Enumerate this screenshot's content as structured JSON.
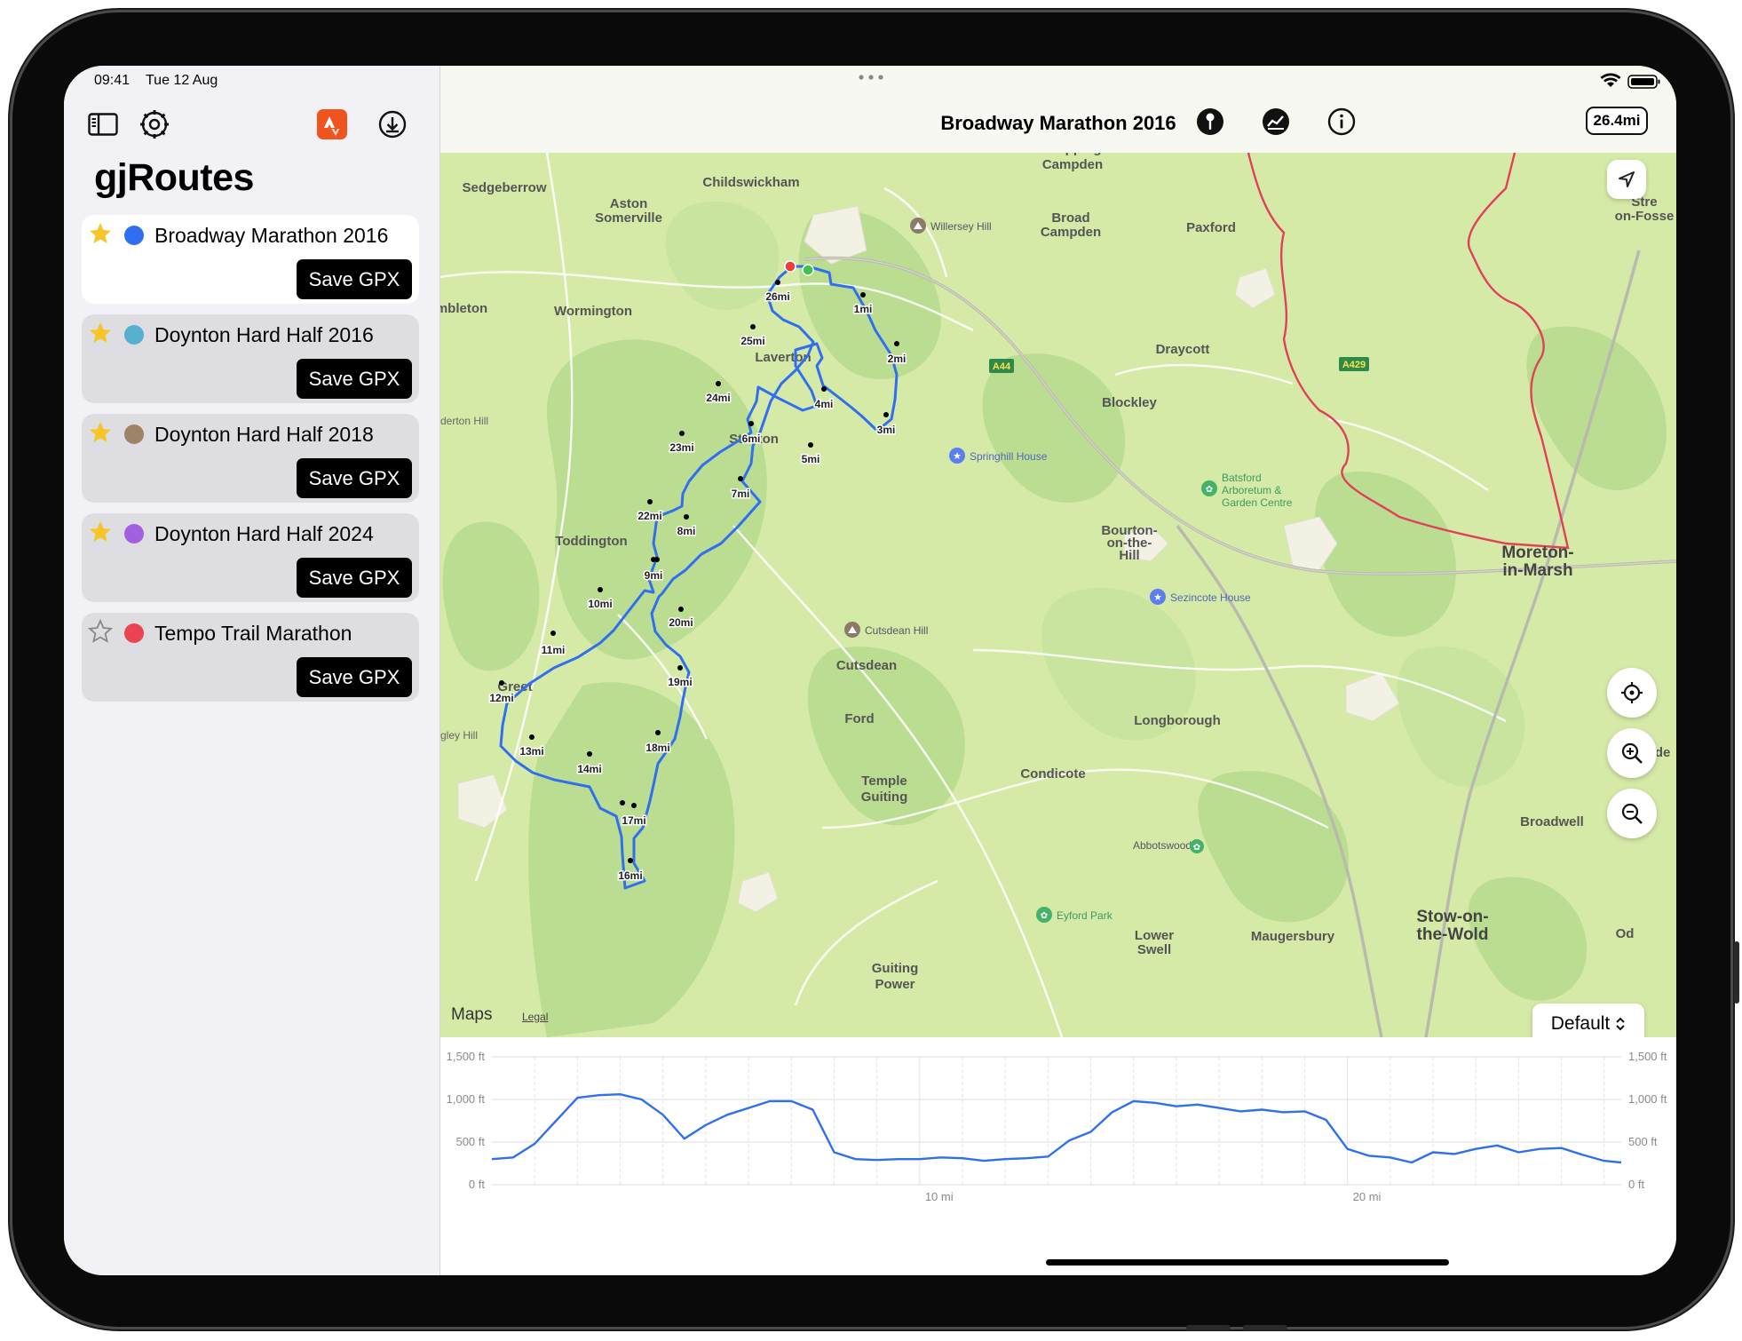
{
  "status": {
    "time": "09:41",
    "date": "Tue 12 Aug"
  },
  "sidebar": {
    "title": "gjRoutes",
    "toolbar_icons": [
      "sidebar-toggle-icon",
      "gear-icon",
      "strava-icon",
      "download-icon"
    ],
    "routes": [
      {
        "name": "Broadway Marathon 2016",
        "color": "#2f6ff0",
        "favorite": true,
        "selected": true,
        "action": "Save GPX"
      },
      {
        "name": "Doynton Hard Half 2016",
        "color": "#57b0cf",
        "favorite": true,
        "selected": false,
        "action": "Save GPX"
      },
      {
        "name": "Doynton Hard Half 2018",
        "color": "#9e8366",
        "favorite": true,
        "selected": false,
        "action": "Save GPX"
      },
      {
        "name": "Doynton Hard Half 2024",
        "color": "#a25fe0",
        "favorite": true,
        "selected": false,
        "action": "Save GPX"
      },
      {
        "name": "Tempo Trail Marathon",
        "color": "#ea4452",
        "favorite": false,
        "selected": false,
        "action": "Save GPX"
      }
    ]
  },
  "navbar": {
    "title": "Broadway Marathon 2016",
    "distance": "26.4mi",
    "icons": [
      "pin-icon",
      "chart-icon",
      "info-icon"
    ]
  },
  "map": {
    "attribution": "Maps",
    "legal": "Legal",
    "map_style": "Default",
    "route_color": "#2f6ff0",
    "places": [
      "Chipping Campden",
      "Sedgeberrow",
      "Childswickham",
      "Aston Somerville",
      "Willersey Hill",
      "Broad Campden",
      "Paxford",
      "Stretton-on-Fosse",
      "Wormington",
      "Laverton",
      "Draycott",
      "Blockley",
      "Springhill House",
      "Stanton",
      "Batsford Arboretum & Garden Centre",
      "Toddington",
      "Bourton-on-the-Hill",
      "Moreton-in-Marsh",
      "Sezincote House",
      "Cutsdean",
      "Cutsdean Hill",
      "Greet",
      "Ford",
      "Longborough",
      "Temple Guiting",
      "Condicote",
      "Evenlode",
      "Broadwell",
      "Abbotswood",
      "Stow-on-the-Wold",
      "Lower Swell",
      "Maugersbury",
      "Guiting Power",
      "Eyford Park",
      "Wormington",
      "A44",
      "A429"
    ],
    "mile_markers": [
      "1mi",
      "2mi",
      "3mi",
      "4mi",
      "5mi",
      "6mi",
      "7mi",
      "8mi",
      "9mi",
      "10mi",
      "11mi",
      "12mi",
      "13mi",
      "14mi",
      "16mi",
      "17mi",
      "18mi",
      "19mi",
      "20mi",
      "22mi",
      "23mi",
      "24mi",
      "25mi",
      "26mi"
    ]
  },
  "elevation": {
    "y_ticks": [
      "1,500 ft",
      "1,000 ft",
      "500 ft",
      "0 ft"
    ],
    "x_ticks": [
      "10 mi",
      "20 mi"
    ]
  },
  "chart_data": {
    "type": "line",
    "title": "",
    "xlabel": "",
    "ylabel": "",
    "ylim": [
      0,
      1500
    ],
    "xlim": [
      0,
      26.4
    ],
    "series": [
      {
        "x": [
          0,
          0.5,
          1,
          1.5,
          2,
          2.5,
          3,
          3.5,
          4,
          4.5,
          5,
          5.5,
          6,
          6.5,
          7,
          7.5,
          8,
          8.5,
          9,
          9.5,
          10,
          10.5,
          11,
          11.5,
          12,
          12.5,
          13,
          13.5,
          14,
          14.5,
          15,
          15.5,
          16,
          16.5,
          17,
          17.5,
          18,
          18.5,
          19,
          19.5,
          20,
          20.5,
          21,
          21.5,
          22,
          22.5,
          23,
          23.5,
          24,
          24.5,
          25,
          25.5,
          26,
          26.4
        ],
        "y": [
          300,
          320,
          480,
          750,
          1020,
          1050,
          1060,
          1000,
          820,
          540,
          700,
          820,
          900,
          980,
          980,
          880,
          380,
          300,
          290,
          300,
          300,
          320,
          310,
          280,
          300,
          310,
          330,
          520,
          620,
          850,
          980,
          960,
          920,
          940,
          900,
          860,
          880,
          850,
          860,
          760,
          420,
          340,
          320,
          260,
          380,
          360,
          420,
          460,
          380,
          420,
          430,
          350,
          280,
          260
        ]
      }
    ]
  }
}
